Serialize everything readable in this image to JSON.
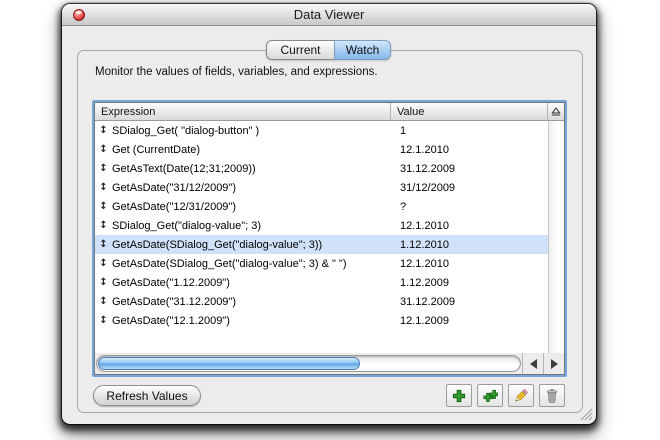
{
  "window": {
    "title": "Data Viewer"
  },
  "tabs": {
    "current_label": "Current",
    "watch_label": "Watch",
    "selected": "Watch"
  },
  "description": "Monitor the values of fields, variables, and expressions.",
  "table": {
    "columns": {
      "expression": "Expression",
      "value": "Value"
    },
    "row_icon": "↕",
    "rows": [
      {
        "expression": "SDialog_Get( \"dialog-button\" )",
        "value": "1",
        "selected": false
      },
      {
        "expression": "Get (CurrentDate)",
        "value": "12.1.2010",
        "selected": false
      },
      {
        "expression": "GetAsText(Date(12;31;2009))",
        "value": "31.12.2009",
        "selected": false
      },
      {
        "expression": "GetAsDate(\"31/12/2009\")",
        "value": "31/12/2009",
        "selected": false
      },
      {
        "expression": "GetAsDate(\"12/31/2009\")",
        "value": "?",
        "selected": false
      },
      {
        "expression": "SDialog_Get(\"dialog-value\"; 3)",
        "value": "12.1.2010",
        "selected": false
      },
      {
        "expression": "GetAsDate(SDialog_Get(\"dialog-value\"; 3))",
        "value": "1.12.2010",
        "selected": true
      },
      {
        "expression": "GetAsDate(SDialog_Get(\"dialog-value\"; 3) & \" \")",
        "value": "12.1.2010",
        "selected": false
      },
      {
        "expression": "GetAsDate(\"1.12.2009\")",
        "value": "1.12.2009",
        "selected": false
      },
      {
        "expression": "GetAsDate(\"31.12.2009\")",
        "value": "31.12.2009",
        "selected": false
      },
      {
        "expression": "GetAsDate(\"12.1.2009\")",
        "value": "12.1.2009",
        "selected": false
      }
    ]
  },
  "scrollbar": {
    "h_thumb_percent": 62
  },
  "actions": {
    "refresh_label": "Refresh Values"
  },
  "icons": {
    "close": "close-icon (red aqua ball)",
    "row": "updown-arrow-icon",
    "sort": "sort-column-icon (triangle over line)",
    "add": "green-plus-icon",
    "add_multiple": "green-double-plus-icon",
    "edit": "pencil-icon",
    "delete": "trash-icon"
  },
  "colors": {
    "selection": "#cfe2f9",
    "focus_ring": "#74a6db",
    "tab_selected": "#86b8ec",
    "plus_green": "#2f9e2f",
    "scroll_thumb": "#5fa5e7"
  }
}
